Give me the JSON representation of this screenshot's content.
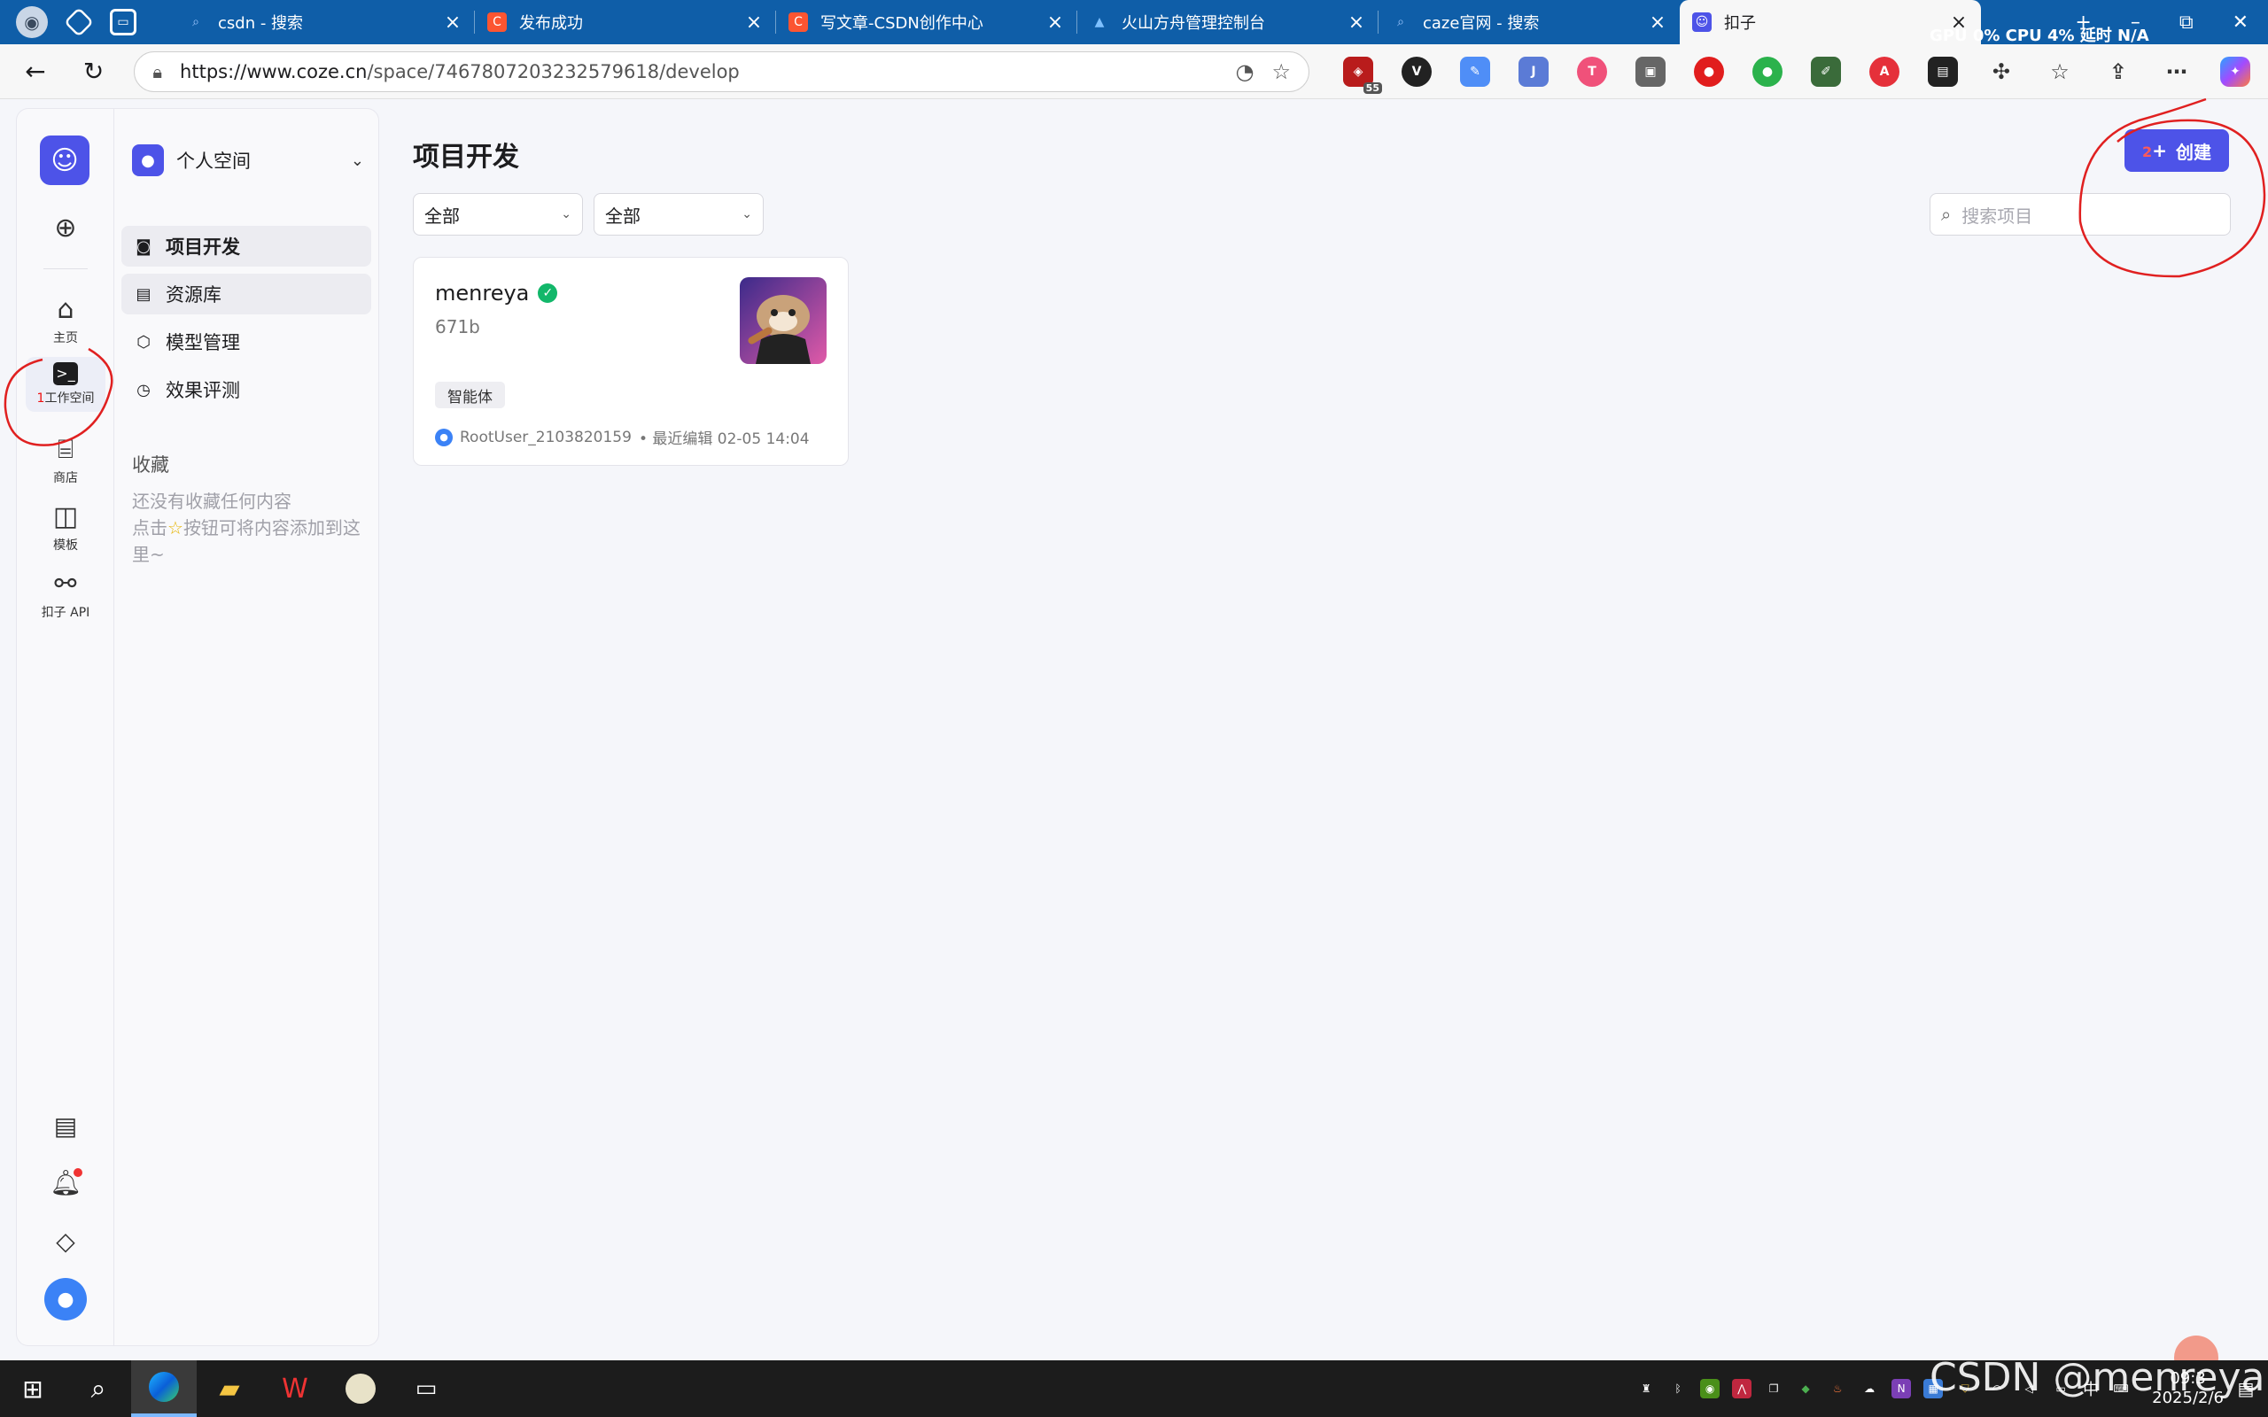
{
  "browser": {
    "tabs": [
      {
        "title": "csdn - 搜索",
        "favicon": "search-icon"
      },
      {
        "title": "发布成功",
        "favicon": "csdn-icon"
      },
      {
        "title": "写文章-CSDN创作中心",
        "favicon": "csdn-icon"
      },
      {
        "title": "火山方舟管理控制台",
        "favicon": "volcano-icon"
      },
      {
        "title": "caze官网 - 搜索",
        "favicon": "search-icon"
      },
      {
        "title": "扣子",
        "favicon": "coze-icon",
        "active": true
      }
    ],
    "new_tab": "+",
    "stats_overlay": "GPU  0%  CPU  4%  延时  N/A",
    "url_domain": "https://www.coze.cn",
    "url_path": "/space/7467807203232579618/develop",
    "extension_badge": "55",
    "colors": {
      "tabbar": "#0f5ea8",
      "accent": "#4d53e8"
    }
  },
  "rail": {
    "items": [
      {
        "label": "主页",
        "icon": "home-icon"
      },
      {
        "label": "工作空间",
        "icon": "terminal-icon",
        "active": true,
        "annotation": "1"
      },
      {
        "label": "商店",
        "icon": "store-icon"
      },
      {
        "label": "模板",
        "icon": "template-icon"
      },
      {
        "label": "扣子 API",
        "icon": "api-icon"
      }
    ]
  },
  "sidebar": {
    "space_name": "个人空间",
    "menu": [
      {
        "label": "项目开发",
        "icon": "bot-icon",
        "active": true
      },
      {
        "label": "资源库",
        "icon": "library-icon"
      },
      {
        "label": "模型管理",
        "icon": "model-icon"
      },
      {
        "label": "效果评测",
        "icon": "gauge-icon"
      }
    ],
    "favorites_title": "收藏",
    "favorites_empty_1": "还没有收藏任何内容",
    "favorites_empty_2a": "点击",
    "favorites_empty_2b": "按钮可将内容添加到这里~"
  },
  "main": {
    "title": "项目开发",
    "create_label": "创建",
    "create_annotation": "2",
    "filter_1": "全部",
    "filter_2": "全部",
    "search_placeholder": "搜索项目",
    "card": {
      "name": "menreya",
      "desc": "671b",
      "tag": "智能体",
      "owner": "RootUser_2103820159",
      "edited": "• 最近编辑 02-05 14:04"
    }
  },
  "taskbar": {
    "clock_time": "09:3",
    "clock_date": "2025/2/6",
    "ime": "中",
    "watermark": "CSDN @menreya"
  }
}
